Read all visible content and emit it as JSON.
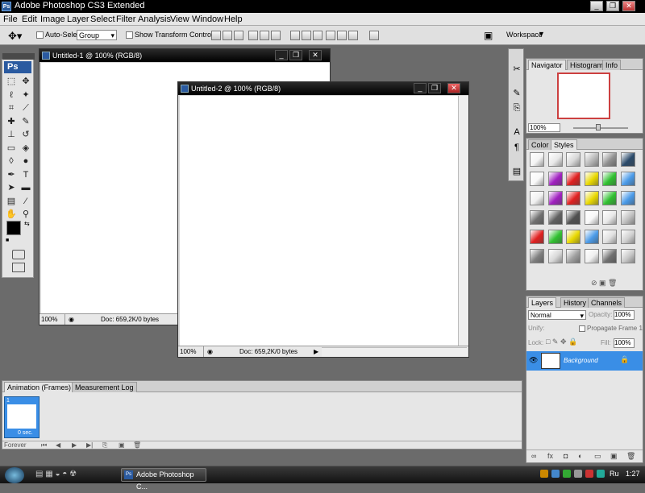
{
  "app": {
    "title": "Adobe Photoshop CS3 Extended",
    "logo": "Ps"
  },
  "window_controls": {
    "minimize": "_",
    "restore": "❐",
    "close": "✕"
  },
  "menu": [
    "File",
    "Edit",
    "Image",
    "Layer",
    "Select",
    "Filter",
    "Analysis",
    "View",
    "Window",
    "Help"
  ],
  "options_bar": {
    "auto_select_label": "Auto-Select:",
    "auto_select_value": "Group",
    "show_transform_label": "Show Transform Controls",
    "workspace_label": "Workspace"
  },
  "documents": [
    {
      "title": "Untitled-1 @ 100% (RGB/8)",
      "zoom": "100%",
      "doc_info": "Doc: 659,2K/0 bytes"
    },
    {
      "title": "Untitled-2 @ 100% (RGB/8)",
      "zoom": "100%",
      "doc_info": "Doc: 659,2K/0 bytes"
    }
  ],
  "navigator_panel": {
    "tabs": [
      "Navigator",
      "Histogram",
      "Info"
    ],
    "zoom": "100%"
  },
  "styles_panel": {
    "tabs": [
      "Color",
      "Styles"
    ]
  },
  "layers_panel": {
    "tabs": [
      "Layers",
      "History",
      "Channels"
    ],
    "blend_mode": "Normal",
    "opacity_label": "Opacity:",
    "opacity_value": "100%",
    "unify_label": "Unify:",
    "propagate_label": "Propagate Frame 1",
    "lock_label": "Lock:",
    "fill_label": "Fill:",
    "fill_value": "100%",
    "layers": [
      {
        "name": "Background"
      }
    ]
  },
  "animation_panel": {
    "tabs": [
      "Animation (Frames)",
      "Measurement Log"
    ],
    "frame_number": "1",
    "frame_delay": "0 sec.",
    "loop": "Forever"
  },
  "taskbar": {
    "button_label": "Adobe Photoshop C...",
    "lang": "Ru",
    "clock": "1:27"
  },
  "colors": {
    "doc_title_active": "#0a2463",
    "selection": "#3a8ee6",
    "style_red": "#e02020",
    "style_yellow": "#e8d800",
    "style_green": "#30c030",
    "style_blue": "#4a9ae8",
    "style_purple": "#a020c0"
  },
  "toolbox_icons": [
    "marquee-icon",
    "move-icon",
    "lasso-icon",
    "magic-wand-icon",
    "crop-icon",
    "slice-icon",
    "healing-brush-icon",
    "brush-icon",
    "clone-stamp-icon",
    "history-brush-icon",
    "eraser-icon",
    "paint-bucket-icon",
    "blur-icon",
    "dodge-icon",
    "pen-icon",
    "type-icon",
    "path-select-icon",
    "shape-icon",
    "notes-icon",
    "eyedropper-icon",
    "hand-icon",
    "zoom-icon"
  ]
}
